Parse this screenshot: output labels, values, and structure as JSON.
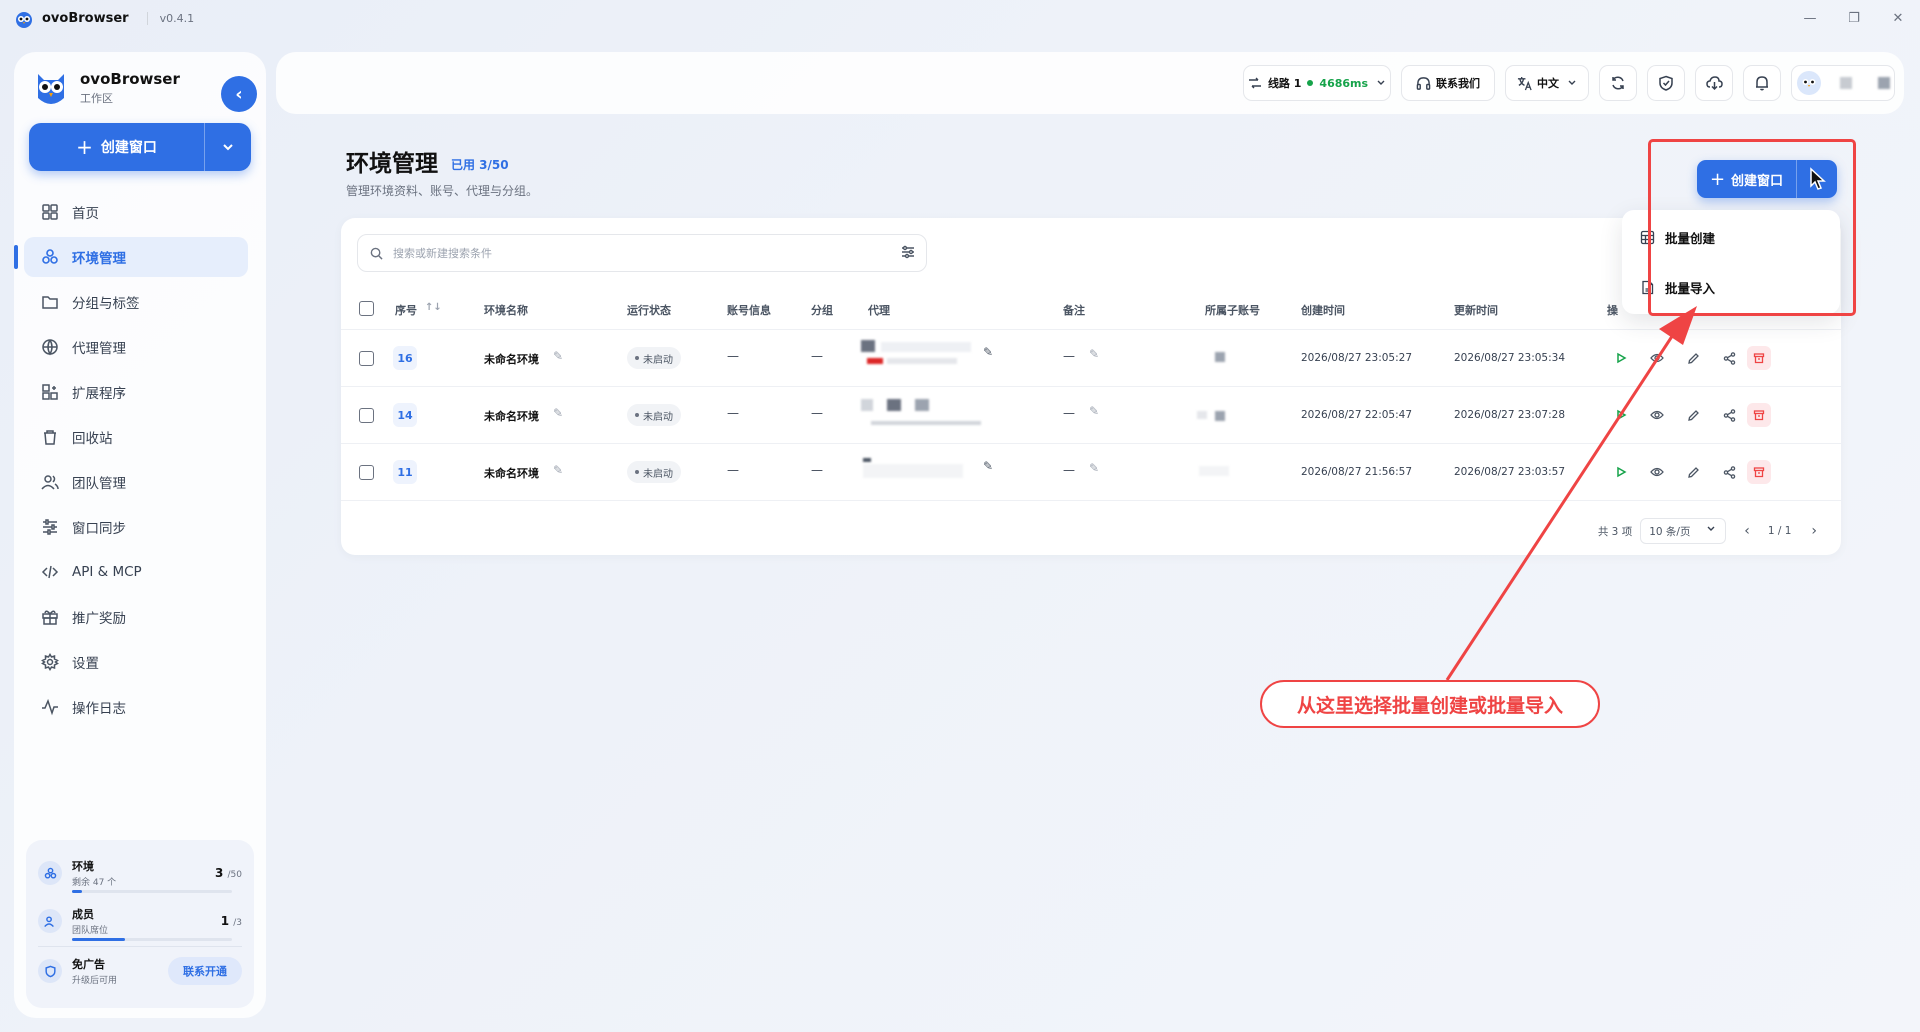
{
  "window": {
    "app_name": "ovoBrowser",
    "version": "v0.4.1"
  },
  "sidebar": {
    "brand_name": "ovoBrowser",
    "brand_sub": "工作区",
    "create_button": "创建窗口",
    "items": [
      {
        "label": "首页",
        "icon": "grid-icon",
        "active": false
      },
      {
        "label": "环境管理",
        "icon": "cluster-icon",
        "active": true
      },
      {
        "label": "分组与标签",
        "icon": "folder-icon",
        "active": false
      },
      {
        "label": "代理管理",
        "icon": "globe-icon",
        "active": false
      },
      {
        "label": "扩展程序",
        "icon": "extension-icon",
        "active": false
      },
      {
        "label": "回收站",
        "icon": "trash-icon",
        "active": false
      },
      {
        "label": "团队管理",
        "icon": "users-icon",
        "active": false
      },
      {
        "label": "窗口同步",
        "icon": "sliders-icon",
        "active": false
      },
      {
        "label": "API & MCP",
        "icon": "code-icon",
        "active": false
      },
      {
        "label": "推广奖励",
        "icon": "gift-icon",
        "active": false
      },
      {
        "label": "设置",
        "icon": "gear-icon",
        "active": false
      },
      {
        "label": "操作日志",
        "icon": "activity-icon",
        "active": false
      }
    ],
    "usage": {
      "env_title": "环境",
      "env_sub": "剩余 47 个",
      "env_used": "3",
      "env_total": "/50",
      "env_fraction": 0.06,
      "member_title": "成员",
      "member_sub": "团队席位",
      "member_used": "1",
      "member_total": "/3",
      "member_fraction": 0.33,
      "ad_title": "免广告",
      "ad_sub": "升级后可用",
      "ad_button": "联系开通"
    }
  },
  "topbar": {
    "line_label": "线路 1",
    "latency": "4686ms",
    "contact": "联系我们",
    "language": "中文",
    "status_color": "#16a34a"
  },
  "page": {
    "title": "环境管理",
    "used": "已用 3/50",
    "description": "管理环境资料、账号、代理与分组。",
    "search_placeholder": "搜索或新建搜索条件",
    "create_button": "创建窗口",
    "dropdown": {
      "batch_create": "批量创建",
      "batch_import": "批量导入"
    }
  },
  "table": {
    "headers": {
      "id": "序号",
      "name": "环境名称",
      "status": "运行状态",
      "account": "账号信息",
      "group": "分组",
      "proxy": "代理",
      "remark": "备注",
      "owner": "所属子账号",
      "created": "创建时间",
      "updated": "更新时间",
      "actions": "操"
    },
    "rows": [
      {
        "id": "16",
        "name": "未命名环境",
        "status": "未启动",
        "account": "—",
        "group": "—",
        "remark": "—",
        "created": "2026/08/27 23:05:27",
        "updated": "2026/08/27 23:05:34"
      },
      {
        "id": "14",
        "name": "未命名环境",
        "status": "未启动",
        "account": "—",
        "group": "—",
        "remark": "—",
        "created": "2026/08/27 22:05:47",
        "updated": "2026/08/27 23:07:28"
      },
      {
        "id": "11",
        "name": "未命名环境",
        "status": "未启动",
        "account": "—",
        "group": "—",
        "remark": "—",
        "created": "2026/08/27 21:56:57",
        "updated": "2026/08/27 23:03:57"
      }
    ],
    "pagination": {
      "total": "共 3 项",
      "page_size": "10 条/页",
      "page": "1 / 1"
    }
  },
  "annotation": {
    "text": "从这里选择批量创建或批量导入",
    "color": "#ef4444"
  },
  "colors": {
    "accent": "#2f6fe4",
    "danger": "#ef4444",
    "success": "#16a34a"
  }
}
